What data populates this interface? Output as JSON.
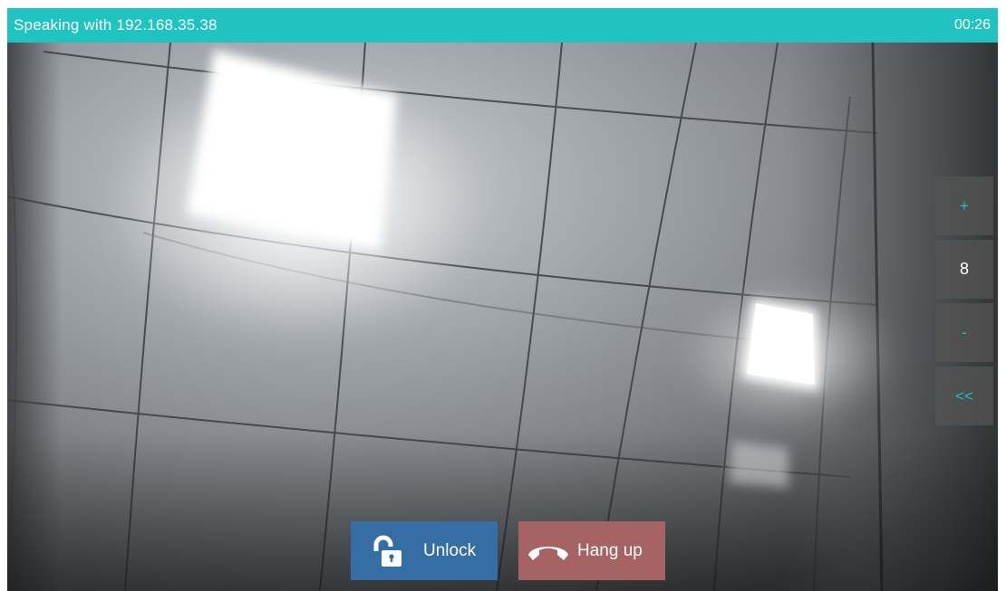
{
  "header": {
    "title": "Speaking with 192.168.35.38",
    "timer": "00:26"
  },
  "zoom": {
    "plus_label": "+",
    "value": "8",
    "minus_label": "-",
    "collapse_label": "<<"
  },
  "actions": {
    "unlock_label": "Unlock",
    "hangup_label": "Hang up"
  },
  "colors": {
    "accent": "#1fc4c0",
    "unlock": "#356ea5",
    "hangup": "#a66364"
  },
  "icons": {
    "unlock": "unlocked-padlock-icon",
    "hangup": "phone-hangup-icon"
  }
}
